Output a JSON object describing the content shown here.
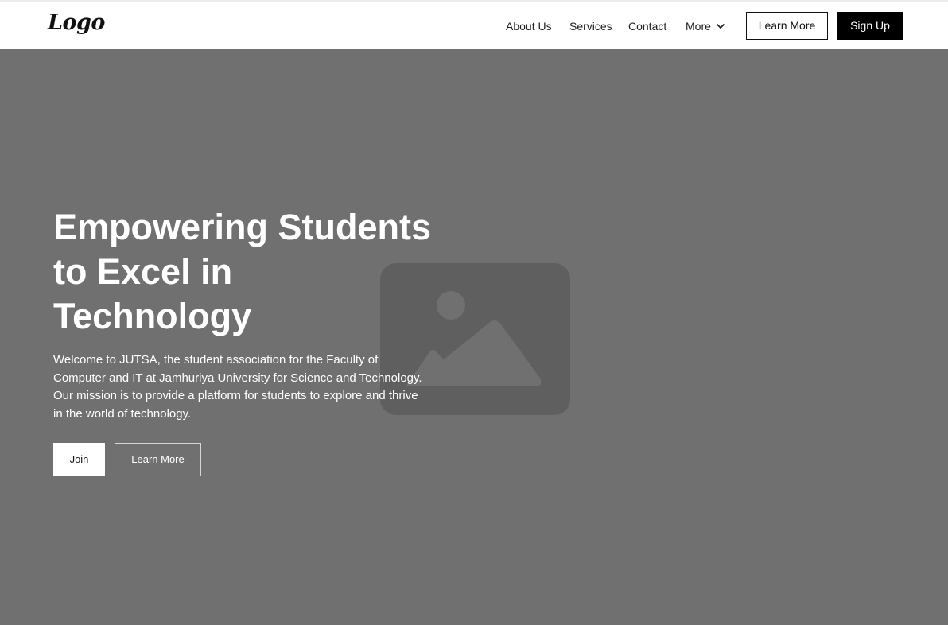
{
  "header": {
    "logo_text": "Logo",
    "nav": [
      {
        "label": "About Us"
      },
      {
        "label": "Services"
      },
      {
        "label": "Contact"
      }
    ],
    "more_label": "More",
    "learn_more_label": "Learn More",
    "signup_label": "Sign Up"
  },
  "hero": {
    "headline": "Empowering Students to Excel in Technology",
    "description": "Welcome to JUTSA, the student association for the Faculty of Computer and IT at Jamhuriya University for Science and Technology. Our mission is to provide a platform for students to explore and thrive in the world of technology.",
    "join_label": "Join",
    "learn_more_label": "Learn More"
  },
  "icons": {
    "chevron": "chevron-down-icon",
    "image": "image-placeholder-icon"
  },
  "colors": {
    "hero_bg": "#707070",
    "placeholder": "#5f5f5f",
    "primary_button_bg": "#000000"
  }
}
